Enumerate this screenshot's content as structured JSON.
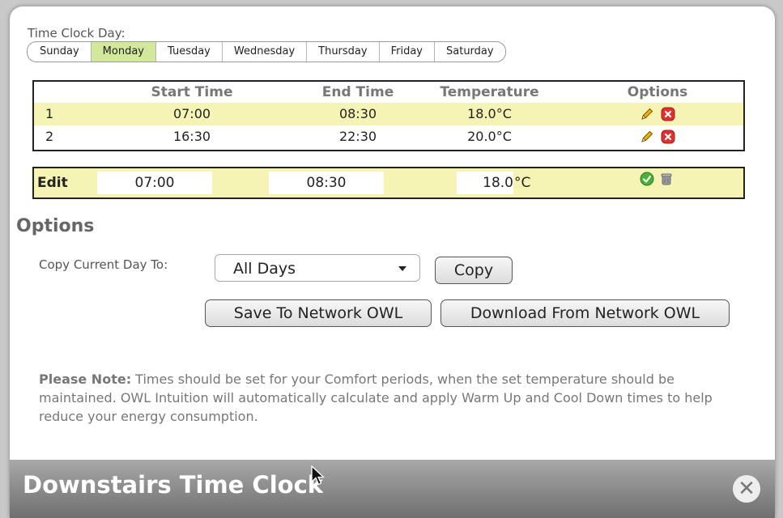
{
  "day_section": {
    "label": "Time Clock Day:",
    "days": [
      "Sunday",
      "Monday",
      "Tuesday",
      "Wednesday",
      "Thursday",
      "Friday",
      "Saturday"
    ],
    "selected": "Monday"
  },
  "schedule": {
    "headers": {
      "start": "Start Time",
      "end": "End Time",
      "temperature": "Temperature",
      "options": "Options"
    },
    "rows": [
      {
        "num": "1",
        "start": "07:00",
        "end": "08:30",
        "temperature": "18.0°C"
      },
      {
        "num": "2",
        "start": "16:30",
        "end": "22:30",
        "temperature": "20.0°C"
      }
    ]
  },
  "edit": {
    "label": "Edit",
    "start": "07:00",
    "end": "08:30",
    "temperature": "18.0",
    "unit": "°C"
  },
  "options": {
    "title": "Options",
    "copy_label": "Copy Current Day To:",
    "copy_select_value": "All Days",
    "copy_button": "Copy",
    "save_button": "Save To Network OWL",
    "download_button": "Download From Network OWL"
  },
  "note": {
    "bold": "Please Note:",
    "text": " Times should be set for your Comfort periods, when the set temperature should be maintained. OWL Intuition will automatically calculate and apply Warm Up and Cool Down times to help reduce your energy consumption."
  },
  "footer": {
    "title": "Downstairs Time Clock"
  },
  "colors": {
    "row_highlight": "#f6f4b5",
    "selected_day": "#d3e89a",
    "delete_red": "#e03131",
    "confirm_green": "#4caf3a"
  }
}
